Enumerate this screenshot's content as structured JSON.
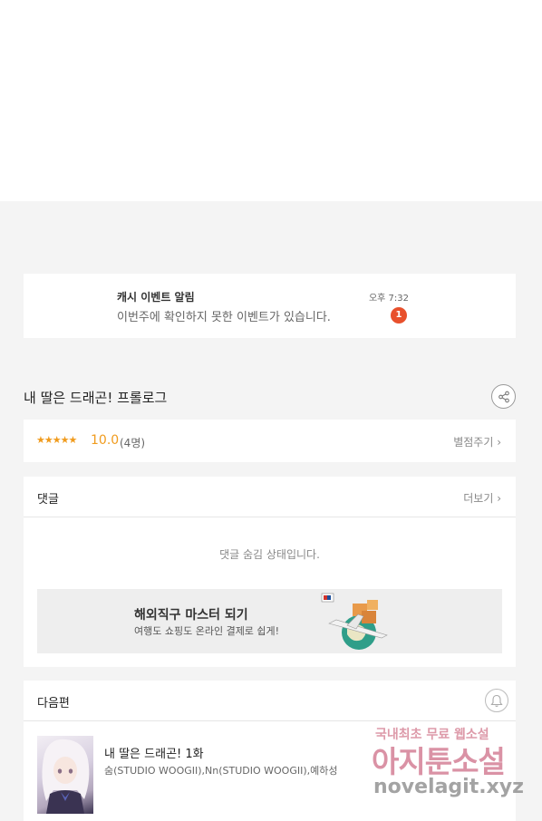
{
  "notification": {
    "title": "캐시 이벤트 알림",
    "time": "오후 7:32",
    "body": "이번주에 확인하지 못한 이벤트가 있습니다.",
    "badge_count": "1"
  },
  "episode": {
    "title": "내 딸은 드래곤! 프롤로그"
  },
  "rating": {
    "stars": "★★★★★",
    "score": "10.0",
    "count": "(4명)",
    "rate_link": "별점주기 ›"
  },
  "comments": {
    "title": "댓글",
    "more_link": "더보기 ›",
    "hidden_message": "댓글 숨김 상태입니다."
  },
  "ad": {
    "title": "해외직구 마스터 되기",
    "subtitle": "여행도 쇼핑도 온라인 결제로 쉽게!"
  },
  "next_episode": {
    "section_title": "다음편",
    "title": "내 딸은 드래곤! 1화",
    "authors": "숨(STUDIO WOOGII),Nn(STUDIO WOOGII),예하성"
  },
  "watermark": {
    "line1": "국내최초 무료 웹소설",
    "line2": "아지툰소설",
    "line3": "novelagit.xyz"
  },
  "colors": {
    "accent_orange": "#f09b1d",
    "badge_red": "#e8502c",
    "background": "#f4f4f4"
  }
}
